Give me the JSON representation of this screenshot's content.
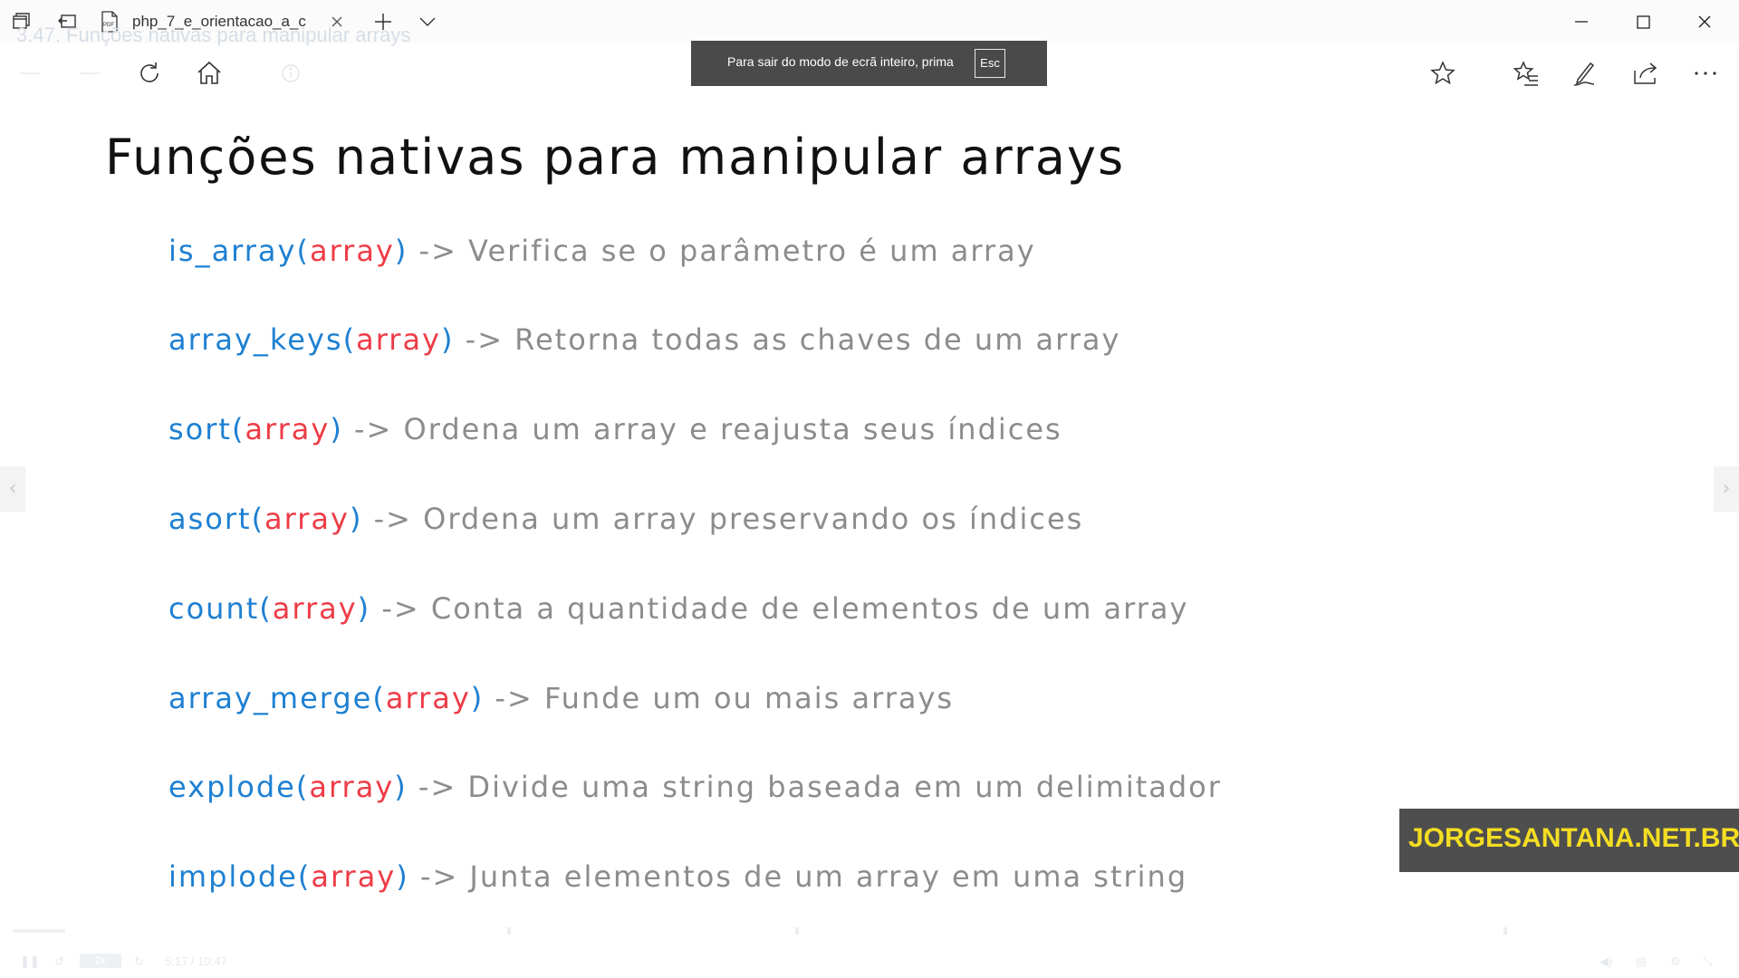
{
  "window": {
    "tab_title": "php_7_e_orientacao_a_c",
    "icons": [
      "tab-list-icon",
      "back-tabs-icon",
      "pdf-icon",
      "close-icon",
      "new-tab-icon",
      "chevron-down-icon",
      "minimize-icon",
      "maximize-icon",
      "close-window-icon"
    ]
  },
  "toolbar": {
    "faded_title": "3.47. Funções nativas para manipular arrays",
    "icons": [
      "back-icon",
      "forward-icon",
      "refresh-icon",
      "home-icon",
      "info-icon",
      "favorite-icon",
      "favorites-list-icon",
      "pen-icon",
      "share-icon",
      "more-icon"
    ]
  },
  "toast": {
    "message": "Para sair do modo de ecrã inteiro, prima",
    "key": "Esc"
  },
  "slide": {
    "title": "Funções nativas para manipular arrays",
    "items": [
      {
        "fn": "is_array(",
        "arg": "array",
        "close": ")",
        "desc": " -> Verifica se o parâmetro é um array"
      },
      {
        "fn": "array_keys(",
        "arg": "array",
        "close": ")",
        "desc": " -> Retorna todas as chaves de um array"
      },
      {
        "fn": "sort(",
        "arg": "array",
        "close": ")",
        "desc": " -> Ordena um array e reajusta seus índices"
      },
      {
        "fn": "asort(",
        "arg": "array",
        "close": ")",
        "desc": " -> Ordena um array preservando os índices"
      },
      {
        "fn": "count(",
        "arg": "array",
        "close": ")",
        "desc": " -> Conta a quantidade de elementos de um array"
      },
      {
        "fn": "array_merge(",
        "arg": "array",
        "close": ")",
        "desc": " -> Funde um ou mais arrays"
      },
      {
        "fn": "explode(",
        "arg": "array",
        "close": ")",
        "desc": " -> Divide uma string baseada em um delimitador"
      },
      {
        "fn": "implode(",
        "arg": "array",
        "close": ")",
        "desc": " -> Junta elementos de um array em uma string"
      }
    ]
  },
  "watermark": "JORGESANTANA.NET.BR",
  "controls": {
    "speed": "2x",
    "time": "5:17 / 10:47"
  },
  "colors": {
    "function": "#1e80d2",
    "argument": "#ee3c47",
    "description": "#8c8c8c",
    "watermark_bg": "#4e4e4e",
    "watermark_text": "#f4dd22"
  }
}
